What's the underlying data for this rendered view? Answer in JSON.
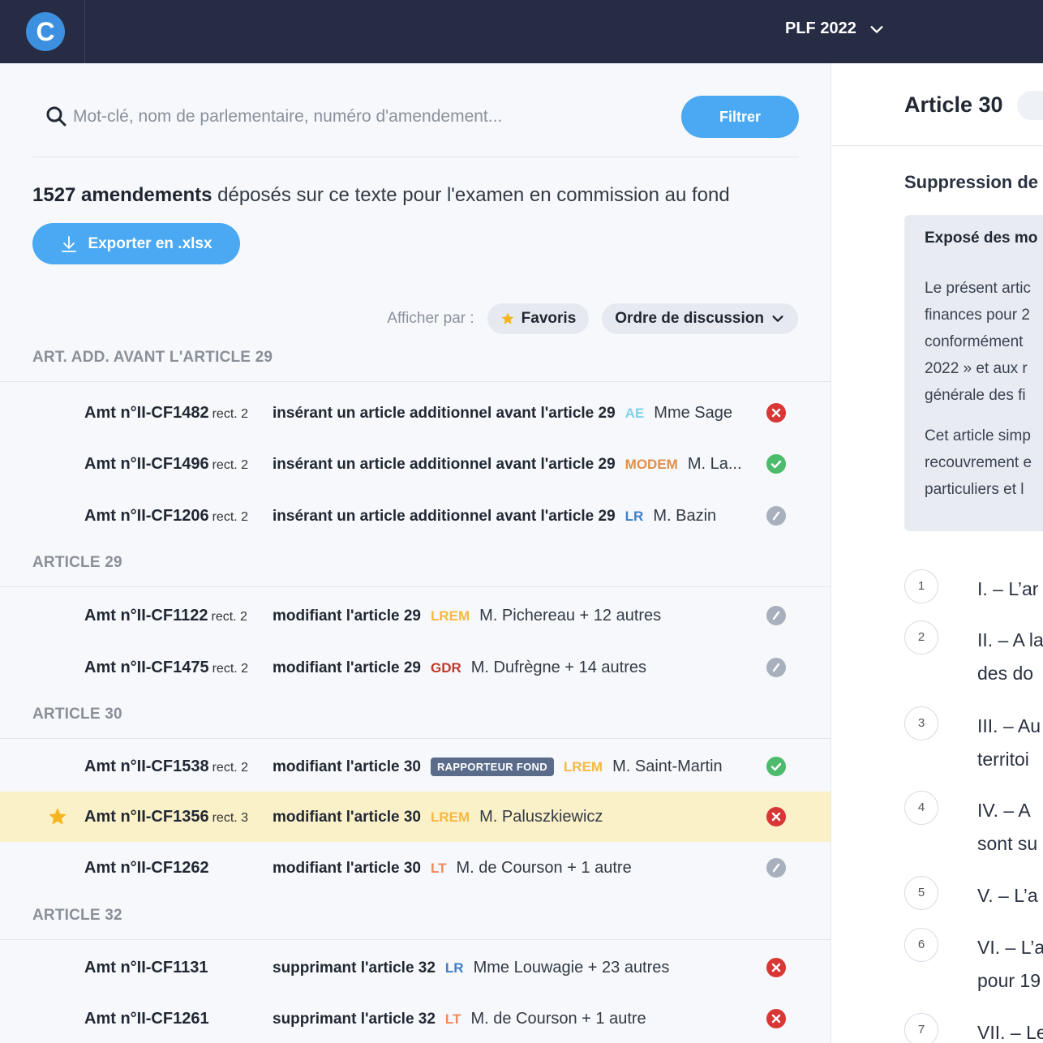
{
  "header": {
    "logo_letter": "C",
    "document": "PLF 2022"
  },
  "search": {
    "placeholder": "Mot-clé, nom de parlementaire, numéro d'amendement...",
    "filter_label": "Filtrer"
  },
  "summary": {
    "count": "1527 amendements",
    "text": "déposés sur ce texte pour l'examen en commission au fond"
  },
  "export_label": "Exporter en .xlsx",
  "display": {
    "label": "Afficher par :",
    "favorites": "Favoris",
    "order": "Ordre de discussion"
  },
  "sections": [
    {
      "title": "ART. ADD. AVANT L'ARTICLE 29",
      "rows": [
        {
          "num": "Amt n°II-CF1482",
          "rect": "rect. 2",
          "desc": "insérant un article additionnel avant l'article 29",
          "group": "AE",
          "group_color": "#7fd3ea",
          "author": "Mme Sage",
          "status": "rejected"
        },
        {
          "num": "Amt n°II-CF1496",
          "rect": "rect. 2",
          "desc": "insérant un article additionnel avant l'article 29",
          "group": "MODEM",
          "group_color": "#e0904a",
          "author": "M. La...",
          "status": "adopted"
        },
        {
          "num": "Amt n°II-CF1206",
          "rect": "rect. 2",
          "desc": "insérant un article additionnel avant l'article 29",
          "group": "LR",
          "group_color": "#3f7fc8",
          "author": "M. Bazin",
          "status": "withdrawn"
        }
      ]
    },
    {
      "title": "ARTICLE 29",
      "rows": [
        {
          "num": "Amt n°II-CF1122",
          "rect": "rect. 2",
          "desc": "modifiant l'article 29",
          "group": "LREM",
          "group_color": "#f5b942",
          "author": "M. Pichereau + 12 autres",
          "status": "withdrawn"
        },
        {
          "num": "Amt n°II-CF1475",
          "rect": "rect. 2",
          "desc": "modifiant l'article 29",
          "group": "GDR",
          "group_color": "#c0392b",
          "author": "M. Dufrègne + 14 autres",
          "status": "withdrawn"
        }
      ]
    },
    {
      "title": "ARTICLE 30",
      "rows": [
        {
          "num": "Amt n°II-CF1538",
          "rect": "rect. 2",
          "desc": "modifiant l'article 30",
          "badge": "RAPPORTEUR FOND",
          "group": "LREM",
          "group_color": "#f5b942",
          "author": "M. Saint-Martin",
          "status": "adopted"
        },
        {
          "num": "Amt n°II-CF1356",
          "rect": "rect. 3",
          "desc": "modifiant l'article 30",
          "group": "LREM",
          "group_color": "#f5b942",
          "author": "M. Paluszkiewicz",
          "status": "rejected",
          "favorite": true
        },
        {
          "num": "Amt n°II-CF1262",
          "rect": "",
          "desc": "modifiant l'article 30",
          "group": "LT",
          "group_color": "#f08a5d",
          "author": "M. de Courson + 1 autre",
          "status": "withdrawn"
        }
      ]
    },
    {
      "title": "ARTICLE 32",
      "rows": [
        {
          "num": "Amt n°II-CF1131",
          "rect": "",
          "desc": "supprimant l'article 32",
          "group": "LR",
          "group_color": "#3f7fc8",
          "author": "Mme Louwagie + 23 autres",
          "status": "rejected"
        },
        {
          "num": "Amt n°II-CF1261",
          "rect": "",
          "desc": "supprimant l'article 32",
          "group": "LT",
          "group_color": "#f08a5d",
          "author": "M. de Courson + 1 autre",
          "status": "rejected"
        }
      ]
    }
  ],
  "article": {
    "title": "Article 30",
    "subtitle": "Suppression de",
    "expose_title": "Exposé des mo",
    "expose_para1": [
      "Le présent artic",
      "finances pour 2",
      "conformément",
      "2022 » et aux r",
      "générale des fi"
    ],
    "expose_para2": [
      "Cet article simp",
      "recouvrement e",
      "particuliers et l"
    ],
    "alineas": [
      {
        "num": "1",
        "lines": [
          "I. – L’ar"
        ]
      },
      {
        "num": "2",
        "lines": [
          "II. – A la",
          "des do"
        ]
      },
      {
        "num": "3",
        "lines": [
          "III. – Au",
          "territoi"
        ]
      },
      {
        "num": "4",
        "lines": [
          "IV. – A",
          "sont su"
        ]
      },
      {
        "num": "5",
        "lines": [
          "V. – L’a"
        ]
      },
      {
        "num": "6",
        "lines": [
          "VI. – L’a",
          "pour 19"
        ]
      },
      {
        "num": "7",
        "lines": [
          "VII. – Le"
        ]
      }
    ]
  },
  "colors": {
    "accent": "#4aa9f2",
    "topbar": "#262c44",
    "adopted": "#4cbb6c",
    "rejected": "#d93636",
    "withdrawn": "#a9b0bd",
    "highlight": "#fbf1c9",
    "star": "#f5b520"
  }
}
